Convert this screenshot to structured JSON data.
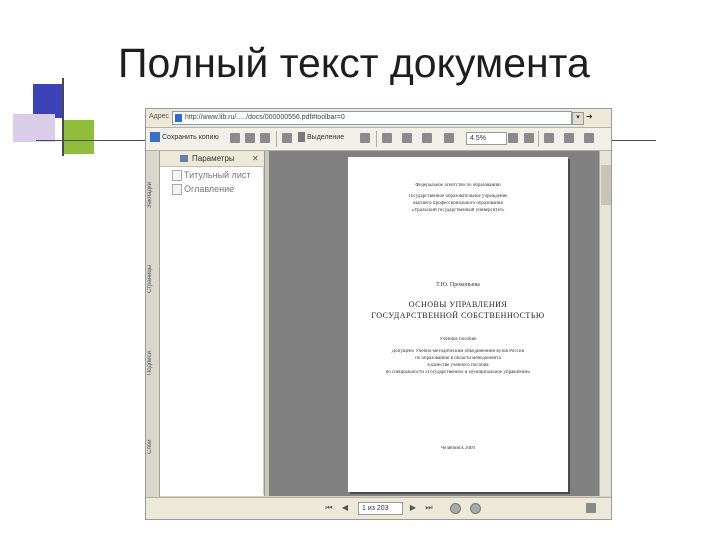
{
  "slide": {
    "title": "Полный текст документа"
  },
  "viewer": {
    "address_label": "Адрес",
    "address_value": "http://www.lib.ru/...../docs/000000556.pdf#toolbar=0",
    "toolbar": {
      "save_copy_label": "Сохранить копию",
      "select_label": "Выделение",
      "zoom_value": "4.5%"
    },
    "side_tabs": [
      "Закладки",
      "Страницы",
      "Подписи",
      "Слои"
    ],
    "navigation": {
      "header_label": "Параметры",
      "items": [
        "Титульный лист",
        "Оглавление"
      ]
    },
    "page": {
      "lines_top": [
        "Федеральное агентство по образованию",
        "Государственное образовательное учреждение",
        "высшего профессионального образования",
        "«Уральский государственный университет»"
      ],
      "author": "Т.Ю. Прокопьева",
      "title_line1": "ОСНОВЫ УПРАВЛЕНИЯ",
      "title_line2": "ГОСУДАРСТВЕННОЙ СОБСТВЕННОСТЬЮ",
      "subtitle": "Учебное пособие",
      "lines_mid": [
        "Допущено Учебно-методическим объединением вузов России",
        "по образованию в области менеджмента",
        "в качестве учебного пособия",
        "по специальности «Государственное и муниципальное управление»"
      ],
      "city_year": "Челябинск 2009"
    },
    "status": {
      "page_indicator": "1 из 203"
    }
  }
}
